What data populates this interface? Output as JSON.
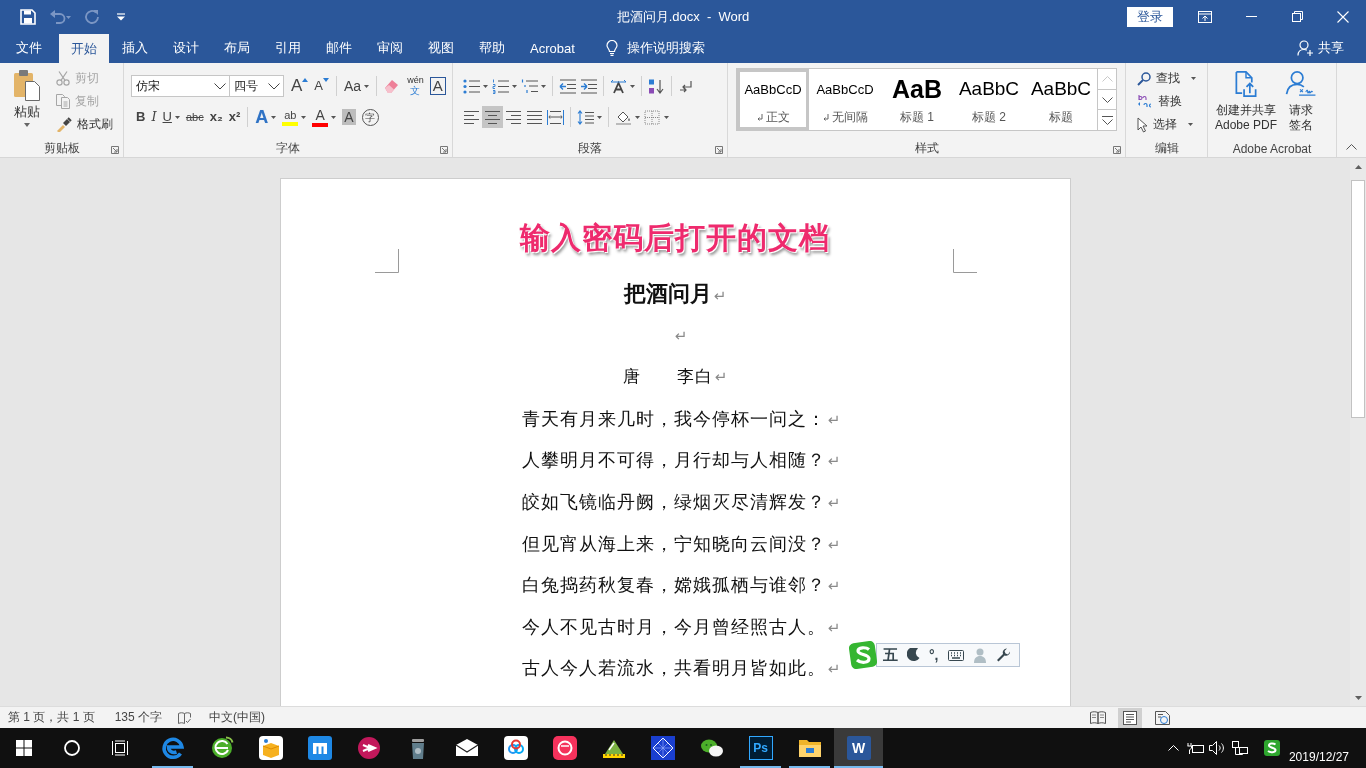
{
  "window": {
    "title": "把酒问月.docx  -  Word",
    "sign_in": "登录"
  },
  "quick_access": [
    {
      "kind": "save",
      "disabled": false
    },
    {
      "kind": "undo",
      "disabled": true
    },
    {
      "kind": "redo",
      "disabled": true
    },
    {
      "kind": "customize",
      "disabled": false
    }
  ],
  "tabs": [
    {
      "label": "文件",
      "selected": false
    },
    {
      "label": "开始",
      "selected": true
    },
    {
      "label": "插入",
      "selected": false
    },
    {
      "label": "设计",
      "selected": false
    },
    {
      "label": "布局",
      "selected": false
    },
    {
      "label": "引用",
      "selected": false
    },
    {
      "label": "邮件",
      "selected": false
    },
    {
      "label": "审阅",
      "selected": false
    },
    {
      "label": "视图",
      "selected": false
    },
    {
      "label": "帮助",
      "selected": false
    },
    {
      "label": "Acrobat",
      "selected": false
    }
  ],
  "tell_me": "操作说明搜索",
  "share": "共享",
  "clipboard": {
    "label": "剪贴板",
    "paste": "粘贴",
    "items": [
      {
        "kind": "cut",
        "label": "剪切",
        "disabled": true
      },
      {
        "kind": "copy",
        "label": "复制",
        "disabled": true
      },
      {
        "kind": "format-painter",
        "label": "格式刷",
        "disabled": false
      }
    ]
  },
  "font": {
    "label": "字体",
    "font_name": "仿宋",
    "font_size": "四号",
    "row_1": [
      {
        "kind": "grow",
        "glyph": "A"
      },
      {
        "kind": "shrink",
        "glyph": "A"
      },
      {
        "kind": "case",
        "glyph": "Aa"
      },
      {
        "kind": "clear"
      },
      {
        "kind": "phonetic",
        "glyph": "wén",
        "glyph_sub": "文"
      },
      {
        "kind": "border",
        "glyph": "A"
      }
    ],
    "row_2": [
      {
        "kind": "bold",
        "glyph": "B"
      },
      {
        "kind": "italic",
        "glyph": "I"
      },
      {
        "kind": "underline",
        "glyph": "U"
      },
      {
        "kind": "strike",
        "glyph": "abc"
      },
      {
        "kind": "subscript",
        "glyph": "x₂"
      },
      {
        "kind": "superscript",
        "glyph": "x²"
      },
      {
        "kind": "effects",
        "glyph": "A"
      },
      {
        "kind": "highlight",
        "glyph": "ab",
        "color": "#ffff00"
      },
      {
        "kind": "color",
        "glyph": "A",
        "color": "#ff0000"
      },
      {
        "kind": "shading",
        "glyph": "A"
      },
      {
        "kind": "enclose",
        "glyph": "字"
      }
    ]
  },
  "paragraph": {
    "label": "段落",
    "row_1": [
      {
        "kind": "bullets"
      },
      {
        "kind": "numbering"
      },
      {
        "kind": "multilevel"
      },
      {
        "kind": "decrease-indent"
      },
      {
        "kind": "increase-indent"
      },
      {
        "kind": "asian-layout"
      },
      {
        "kind": "sort"
      },
      {
        "kind": "show-hide"
      }
    ],
    "row_2": [
      {
        "kind": "align-left",
        "selected": false
      },
      {
        "kind": "align-center",
        "selected": true
      },
      {
        "kind": "align-right",
        "selected": false
      },
      {
        "kind": "justify",
        "selected": false
      },
      {
        "kind": "distribute",
        "selected": false
      },
      {
        "kind": "line-spacing"
      },
      {
        "kind": "shading-fill"
      },
      {
        "kind": "borders"
      }
    ]
  },
  "styles": {
    "label": "样式",
    "scroll_up_disabled": true,
    "items": [
      {
        "kind": "body",
        "preview": "AaBbCcD",
        "label": "正文",
        "selected": true
      },
      {
        "kind": "no-spacing",
        "preview": "AaBbCcD",
        "label": "无间隔",
        "selected": false
      },
      {
        "kind": "heading-1",
        "preview": "AaB",
        "label": "标题 1",
        "selected": false
      },
      {
        "kind": "heading-2",
        "preview": "AaBbC",
        "label": "标题 2",
        "selected": false
      },
      {
        "kind": "title",
        "preview": "AaBbC",
        "label": "标题",
        "selected": false
      }
    ]
  },
  "editing": {
    "label": "编辑",
    "items": [
      {
        "kind": "find",
        "label": "查找"
      },
      {
        "kind": "replace",
        "label": "替换"
      },
      {
        "kind": "select",
        "label": "选择"
      }
    ]
  },
  "acrobat": {
    "label": "Adobe Acrobat",
    "items": [
      {
        "kind": "create-pdf",
        "lines": [
          "创建并共享",
          "Adobe PDF"
        ]
      },
      {
        "kind": "request-signature",
        "lines": [
          "请求",
          "签名"
        ]
      }
    ]
  },
  "document": {
    "annotation": "输入密码后打开的文档",
    "paragraphs": [
      {
        "kind": "title",
        "text": "把酒问月",
        "mark": "↵"
      },
      {
        "kind": "blank",
        "mark": "↵"
      },
      {
        "kind": "author",
        "text": "唐　　李白",
        "mark": "↵"
      },
      {
        "kind": "verse",
        "text": "青天有月来几时，我今停杯一问之：",
        "mark": "↵"
      },
      {
        "kind": "verse",
        "text": "人攀明月不可得，月行却与人相随？",
        "mark": "↵"
      },
      {
        "kind": "verse",
        "text": "皎如飞镜临丹阙，绿烟灭尽清辉发？",
        "mark": "↵"
      },
      {
        "kind": "verse",
        "text": "但见宵从海上来，宁知晓向云间没？",
        "mark": "↵"
      },
      {
        "kind": "verse",
        "text": "白兔捣药秋复春，嫦娥孤栖与谁邻？",
        "mark": "↵"
      },
      {
        "kind": "verse",
        "text": "今人不见古时月，今月曾经照古人。",
        "mark": "↵"
      },
      {
        "kind": "verse",
        "text": "古人今人若流水，共看明月皆如此。",
        "mark": "↵"
      }
    ]
  },
  "ime_toolbar": {
    "mode": "五",
    "punctuation": "°,"
  },
  "status_bar": {
    "page": "第 1 页，共 1 页",
    "words": "135 个字",
    "language": "中文(中国)",
    "views": [
      {
        "kind": "read",
        "selected": false
      },
      {
        "kind": "print",
        "selected": true
      },
      {
        "kind": "web",
        "selected": false
      }
    ]
  },
  "taskbar": {
    "apps": [
      {
        "kind": "edge",
        "running": true,
        "active": false
      },
      {
        "kind": "globe",
        "running": false,
        "active": false
      },
      {
        "kind": "box",
        "running": false,
        "active": false
      },
      {
        "kind": "maxthon",
        "running": false,
        "active": false
      },
      {
        "kind": "arrow",
        "running": false,
        "active": false
      },
      {
        "kind": "bin",
        "running": false,
        "active": false
      },
      {
        "kind": "mail",
        "running": false,
        "active": false
      },
      {
        "kind": "cloud",
        "running": false,
        "active": false
      },
      {
        "kind": "camera",
        "running": false,
        "active": false
      },
      {
        "kind": "ruler",
        "running": false,
        "active": false
      },
      {
        "kind": "grid",
        "running": false,
        "active": false
      },
      {
        "kind": "chat",
        "running": false,
        "active": false
      },
      {
        "kind": "ps",
        "glyph": "Ps",
        "running": true,
        "active": false
      },
      {
        "kind": "folder",
        "running": true,
        "active": false
      },
      {
        "kind": "word",
        "glyph": "W",
        "running": true,
        "active": true
      }
    ],
    "date": "2019/12/27"
  }
}
